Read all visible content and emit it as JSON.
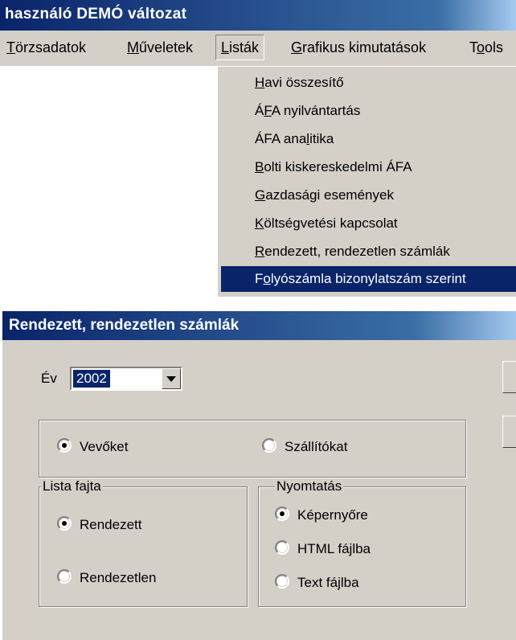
{
  "app": {
    "title": "használó  DEMÓ változat"
  },
  "menubar": {
    "items": [
      {
        "pre": "",
        "acc": "T",
        "post": "örzsadatok"
      },
      {
        "pre": "",
        "acc": "M",
        "post": "űveletek"
      },
      {
        "pre": "",
        "acc": "L",
        "post": "isták"
      },
      {
        "pre": "",
        "acc": "G",
        "post": "rafikus kimutatások"
      },
      {
        "pre": "T",
        "acc": "o",
        "post": "ols"
      }
    ]
  },
  "dropdown": {
    "items": [
      {
        "pre": "",
        "acc": "H",
        "post": "avi összesítő"
      },
      {
        "pre": "Á",
        "acc": "F",
        "post": "A nyilvántartás"
      },
      {
        "pre": "ÁFA ana",
        "acc": "l",
        "post": "itika"
      },
      {
        "pre": "",
        "acc": "B",
        "post": "olti kiskereskedelmi ÁFA"
      },
      {
        "pre": "",
        "acc": "G",
        "post": "azdasági események"
      },
      {
        "pre": "",
        "acc": "K",
        "post": "öltségvetési kapcsolat"
      },
      {
        "pre": "",
        "acc": "R",
        "post": "endezett, rendezetlen számlák"
      },
      {
        "pre": "F",
        "acc": "o",
        "post": "lyószámla bizonylatszám szerint"
      }
    ]
  },
  "dialog": {
    "title": "Rendezett, rendezetlen számlák",
    "year_label": "Év",
    "year_value": "2002",
    "partner": {
      "customers": "Vevőket",
      "suppliers": "Szállítókat"
    },
    "list_type": {
      "legend": "Lista fajta",
      "ordered": "Rendezett",
      "unordered": "Rendezetlen"
    },
    "print": {
      "legend": "Nyomtatás",
      "screen": "Képernyőre",
      "html": "HTML fájlba",
      "text": "Text fájlba"
    }
  }
}
